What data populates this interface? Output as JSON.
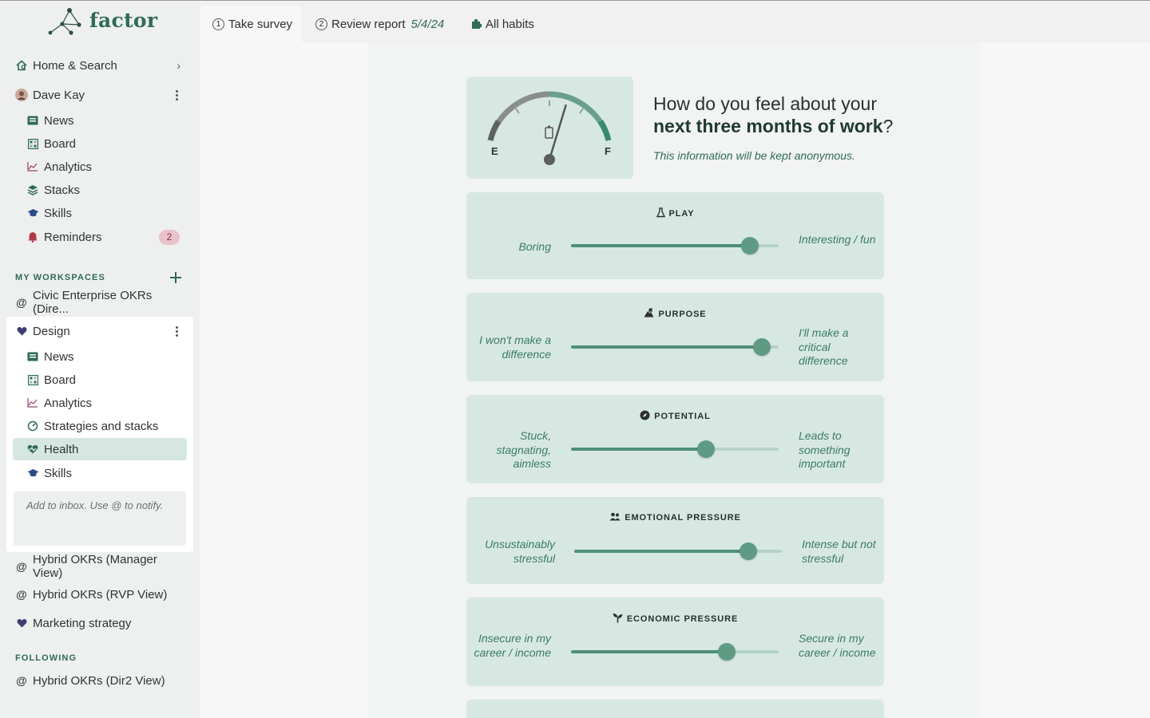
{
  "app": {
    "logo_text": "factor"
  },
  "sidebar": {
    "home": "Home & Search",
    "user": "Dave Kay",
    "user_items": [
      {
        "label": "News"
      },
      {
        "label": "Board"
      },
      {
        "label": "Analytics"
      },
      {
        "label": "Stacks"
      },
      {
        "label": "Skills"
      },
      {
        "label": "Reminders",
        "badge": "2"
      }
    ],
    "my_workspaces_label": "MY WORKSPACES",
    "workspace_civic": "Civic Enterprise OKRs (Dire...",
    "workspace_design": "Design",
    "design_items": [
      {
        "label": "News"
      },
      {
        "label": "Board"
      },
      {
        "label": "Analytics"
      },
      {
        "label": "Strategies and stacks"
      },
      {
        "label": "Health"
      },
      {
        "label": "Skills"
      }
    ],
    "inbox_placeholder": "Add to inbox. Use @ to notify.",
    "workspaces_more": [
      "Hybrid OKRs (Manager View)",
      "Hybrid OKRs (RVP View)",
      "Marketing strategy"
    ],
    "following_label": "FOLLOWING",
    "following": [
      "Hybrid OKRs (Dir2 View)"
    ]
  },
  "tabs": {
    "take_survey": {
      "num": "1",
      "label": "Take survey"
    },
    "review_report": {
      "num": "2",
      "label": "Review report",
      "date": "5/4/24"
    },
    "all_habits": {
      "label": "All habits"
    }
  },
  "survey": {
    "question_pre": "How do you feel about your",
    "question_bold": "next three months of work",
    "question_post": "?",
    "anon_note": "This information will be kept anonymous.",
    "gauge": {
      "e_label": "E",
      "f_label": "F",
      "level": 0.62
    },
    "sliders": [
      {
        "title": "PLAY",
        "left": "Boring",
        "right": "Interesting / fun",
        "value": 0.86
      },
      {
        "title": "PURPOSE",
        "left": "I won't make a difference",
        "right": "I'll make a critical difference",
        "value": 0.92
      },
      {
        "title": "POTENTIAL",
        "left": "Stuck, stagnating, aimless",
        "right": "Leads to something important",
        "value": 0.65
      },
      {
        "title": "EMOTIONAL PRESSURE",
        "left": "Unsustainably stressful",
        "right": "Intense but not stressful",
        "value": 0.84
      },
      {
        "title": "ECONOMIC PRESSURE",
        "left": "Insecure in my career / income",
        "right": "Secure in my career / income",
        "value": 0.75
      }
    ]
  },
  "colors": {
    "accent": "#2f6a5a",
    "card": "#d7e8e2",
    "active": "#d5e7e0"
  }
}
